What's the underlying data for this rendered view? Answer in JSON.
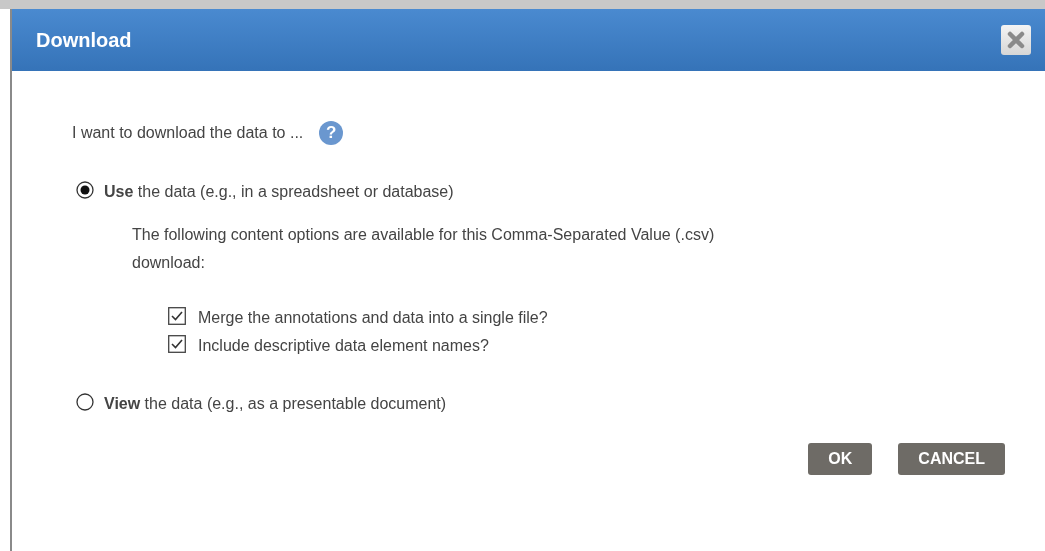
{
  "window": {
    "title": "Download"
  },
  "prompt": "I want to download the data to ...",
  "help": "?",
  "options": [
    {
      "label": "**Use** the data (e.g., in a spreadsheet or database)",
      "selected": true,
      "description": "The following content options are available for this Comma-Separated Value (.csv) download:",
      "checkboxes": [
        {
          "label": "Merge the annotations and data into a single file?",
          "checked": true
        },
        {
          "label": "Include descriptive data element names?",
          "checked": true
        }
      ]
    },
    {
      "label": "**View** the data (e.g., as a presentable document)",
      "selected": false
    }
  ],
  "buttons": [
    "OK",
    "CANCEL"
  ]
}
